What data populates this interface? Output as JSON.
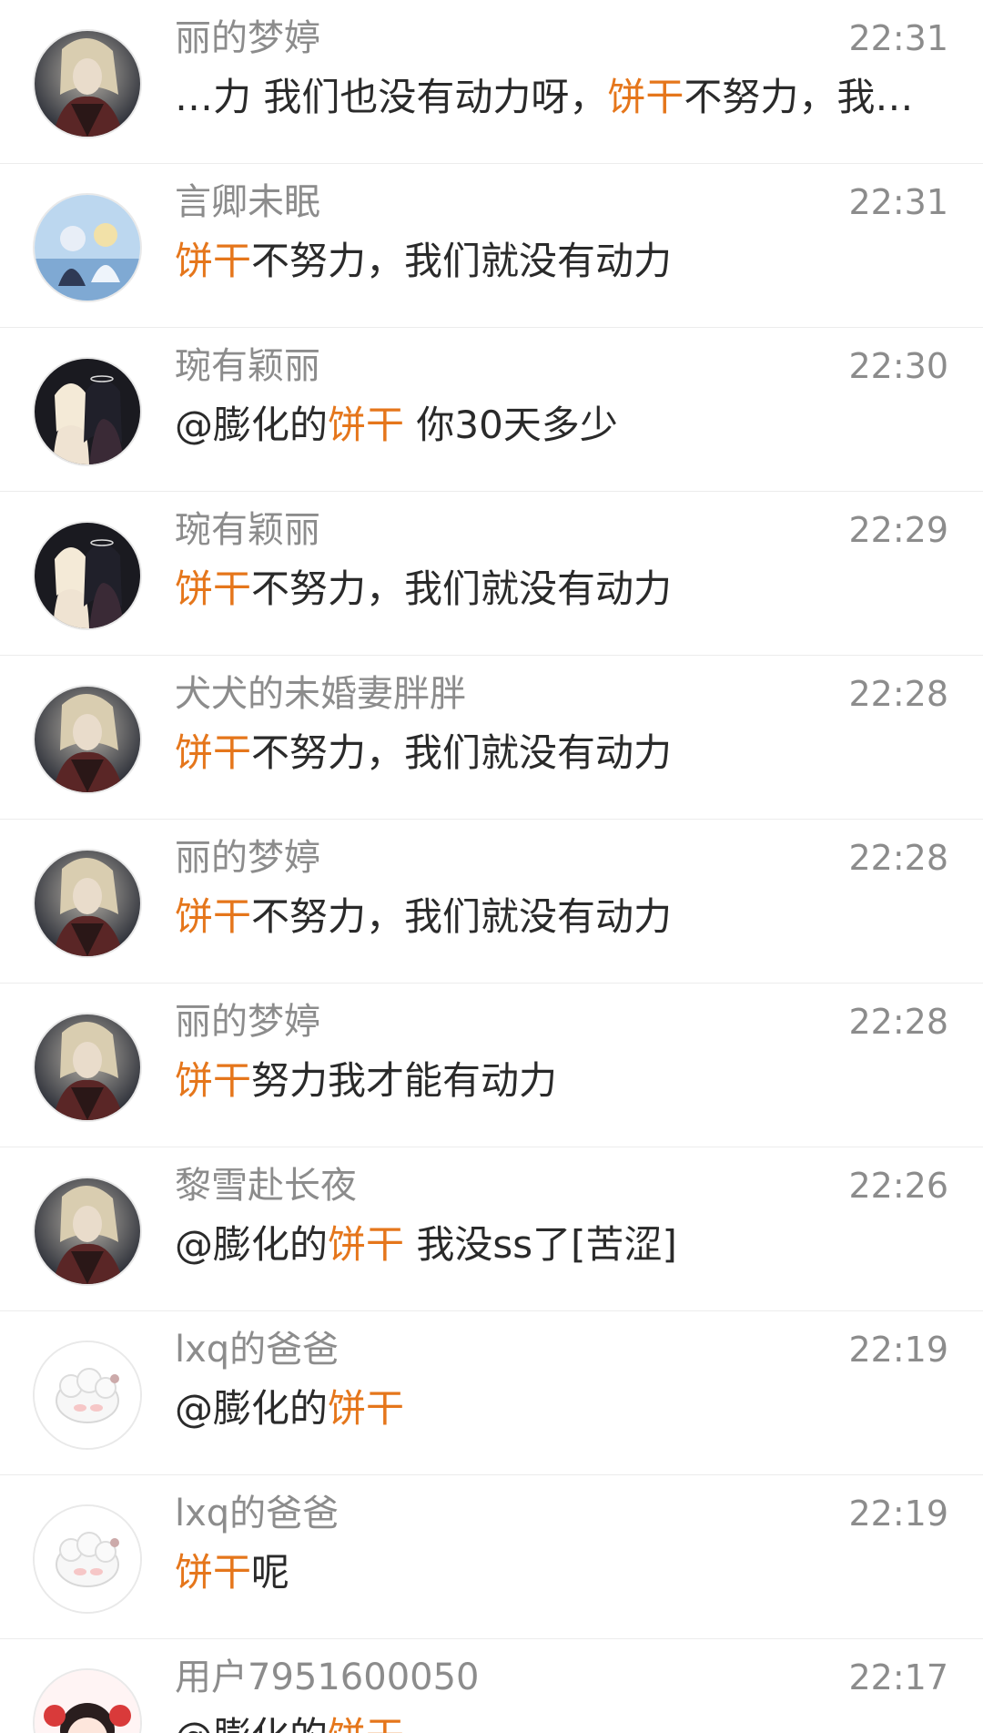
{
  "highlight_color": "#e5761b",
  "rows": [
    {
      "name": "丽的梦婷",
      "time": "22:31",
      "avatar": "dark-warrior-avatar-icon",
      "message": [
        {
          "text": "…力 我们也没有动力呀，"
        },
        {
          "text": "饼干",
          "hl": true
        },
        {
          "text": "不努力，我们…"
        }
      ]
    },
    {
      "name": "言卿未眠",
      "time": "22:31",
      "avatar": "blue-anime-couple-avatar-icon",
      "message": [
        {
          "text": "饼干",
          "hl": true
        },
        {
          "text": "不努力，我们就没有动力"
        }
      ]
    },
    {
      "name": "琬有颖丽",
      "time": "22:30",
      "avatar": "angel-demon-avatar-icon",
      "message": [
        {
          "text": "@膨化的"
        },
        {
          "text": "饼干",
          "hl": true
        },
        {
          "text": " 你30天多少"
        }
      ]
    },
    {
      "name": "琬有颖丽",
      "time": "22:29",
      "avatar": "angel-demon-avatar-icon",
      "message": [
        {
          "text": "饼干",
          "hl": true
        },
        {
          "text": "不努力，我们就没有动力"
        }
      ]
    },
    {
      "name": "犬犬的未婚妻胖胖",
      "time": "22:28",
      "avatar": "dark-warrior-avatar-icon",
      "message": [
        {
          "text": "饼干",
          "hl": true
        },
        {
          "text": "不努力，我们就没有动力"
        }
      ]
    },
    {
      "name": "丽的梦婷",
      "time": "22:28",
      "avatar": "dark-warrior-avatar-icon",
      "message": [
        {
          "text": "饼干",
          "hl": true
        },
        {
          "text": "不努力，我们就没有动力"
        }
      ]
    },
    {
      "name": "丽的梦婷",
      "time": "22:28",
      "avatar": "dark-warrior-avatar-icon",
      "message": [
        {
          "text": "饼干",
          "hl": true
        },
        {
          "text": "努力我才能有动力"
        }
      ]
    },
    {
      "name": "黎雪赴长夜",
      "time": "22:26",
      "avatar": "dark-warrior-avatar-icon",
      "message": [
        {
          "text": "@膨化的"
        },
        {
          "text": "饼干",
          "hl": true
        },
        {
          "text": " 我没ss了[苦涩]"
        }
      ]
    },
    {
      "name": "lxq的爸爸",
      "time": "22:19",
      "avatar": "white-sheep-avatar-icon",
      "message": [
        {
          "text": "@膨化的"
        },
        {
          "text": "饼干",
          "hl": true
        }
      ]
    },
    {
      "name": "lxq的爸爸",
      "time": "22:19",
      "avatar": "white-sheep-avatar-icon",
      "message": [
        {
          "text": "饼干",
          "hl": true
        },
        {
          "text": "呢"
        }
      ]
    },
    {
      "name": "用户7951600050",
      "time": "22:17",
      "avatar": "anime-girl-red-bows-avatar-icon",
      "message": [
        {
          "text": "@膨化的"
        },
        {
          "text": "饼干",
          "hl": true
        }
      ]
    }
  ]
}
